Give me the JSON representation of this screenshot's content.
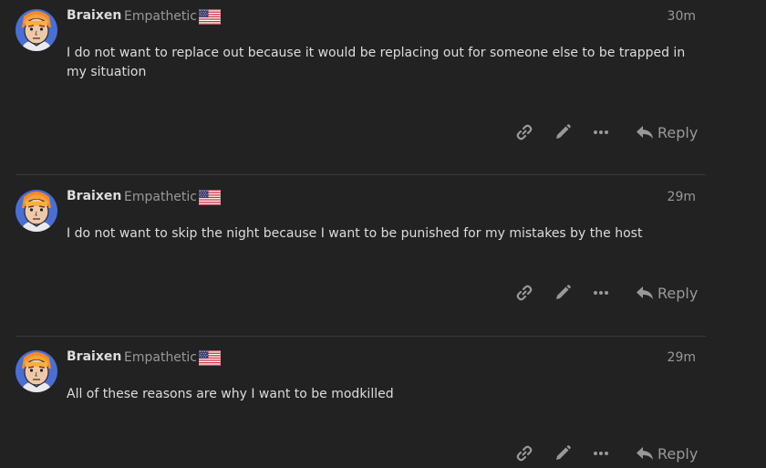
{
  "posts": [
    {
      "username": "Braixen",
      "user_title": "Empathetic",
      "flag_icon": "us-flag-icon",
      "date": "30m",
      "body": "I do not want to replace out because it would be replacing out for someone else to be trapped in my situation",
      "reply_label": "Reply"
    },
    {
      "username": "Braixen",
      "user_title": "Empathetic",
      "flag_icon": "us-flag-icon",
      "date": "29m",
      "body": "I do not want to skip the night because I want to be punished for my mistakes by the host",
      "reply_label": "Reply"
    },
    {
      "username": "Braixen",
      "user_title": "Empathetic",
      "flag_icon": "us-flag-icon",
      "date": "29m",
      "body": "All of these reasons are why I want to be modkilled",
      "reply_label": "Reply"
    }
  ],
  "icons": {
    "copy_link": "link-icon",
    "edit": "pencil-icon",
    "more": "ellipsis-icon",
    "reply": "reply-arrow-icon"
  },
  "colors": {
    "background": "#222222",
    "text": "#dddddd",
    "muted": "#999999",
    "divider": "#3a3a3a"
  }
}
